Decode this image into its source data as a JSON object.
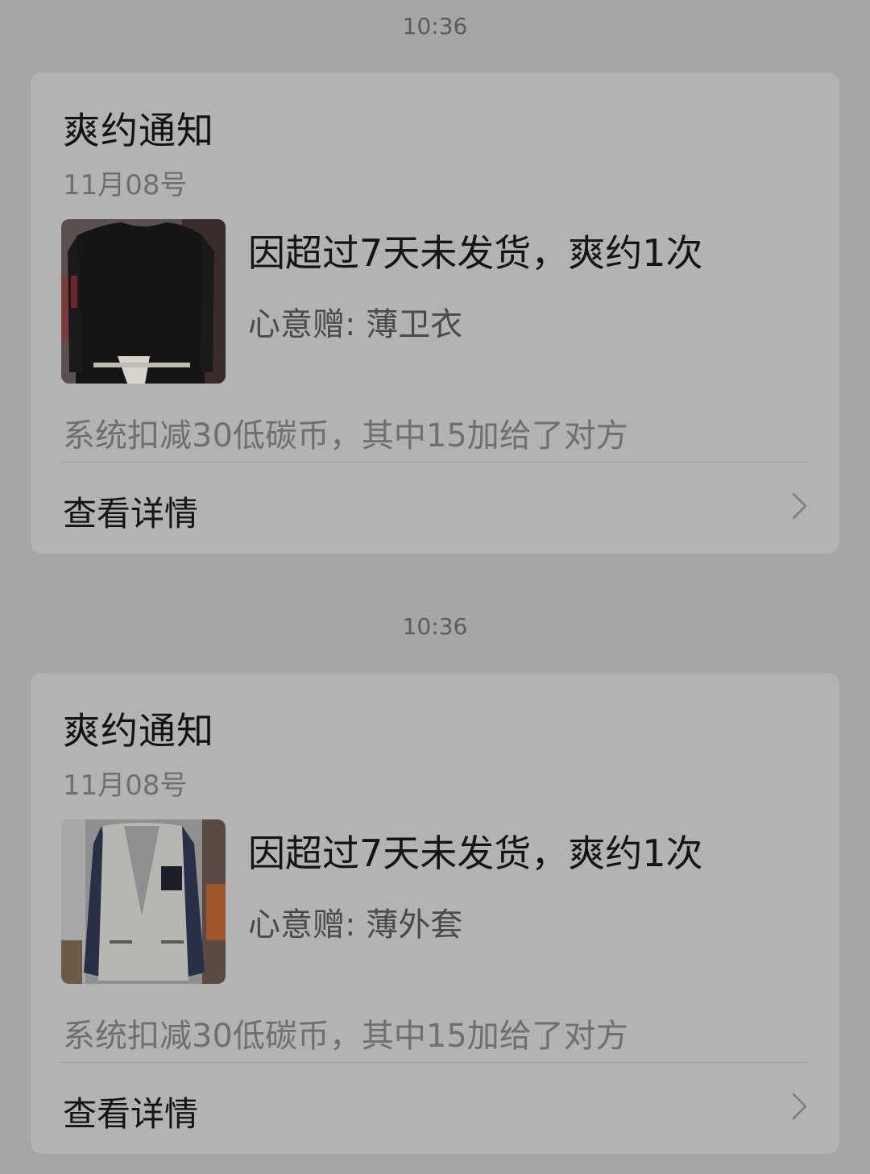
{
  "notifications": [
    {
      "time": "10:36",
      "title": "爽约通知",
      "date": "11月08号",
      "headline": "因超过7天未发货，爽约1次",
      "gift": "心意赠: 薄卫衣",
      "deduction": "系统扣减30低碳币，其中15加给了对方",
      "details_label": "查看详情",
      "thumbnail_icon": "black-sweatshirt-photo",
      "chevron_icon": "chevron-right-icon"
    },
    {
      "time": "10:36",
      "title": "爽约通知",
      "date": "11月08号",
      "headline": "因超过7天未发货，爽约1次",
      "gift": "心意赠: 薄外套",
      "deduction": "系统扣减30低碳币，其中15加给了对方",
      "details_label": "查看详情",
      "thumbnail_icon": "jacket-photo",
      "chevron_icon": "chevron-right-icon"
    }
  ]
}
